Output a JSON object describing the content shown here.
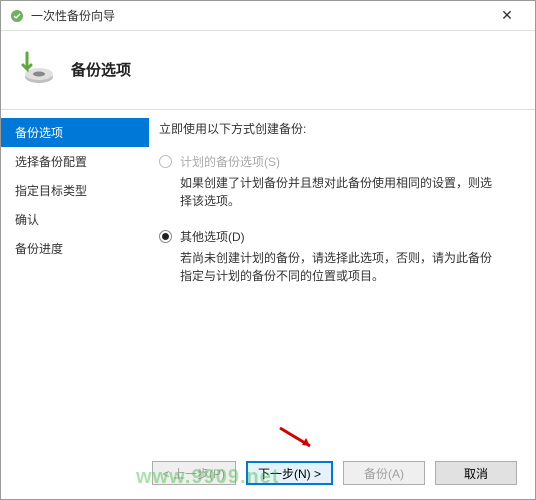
{
  "window": {
    "title": "一次性备份向导"
  },
  "header": {
    "title": "备份选项"
  },
  "sidebar": {
    "items": [
      {
        "label": "备份选项",
        "active": true
      },
      {
        "label": "选择备份配置",
        "active": false
      },
      {
        "label": "指定目标类型",
        "active": false
      },
      {
        "label": "确认",
        "active": false
      },
      {
        "label": "备份进度",
        "active": false
      }
    ]
  },
  "content": {
    "lead": "立即使用以下方式创建备份:",
    "options": [
      {
        "label": "计划的备份选项(S)",
        "desc": "如果创建了计划备份并且想对此备份使用相同的设置，则选择该选项。",
        "checked": false,
        "disabled": true
      },
      {
        "label": "其他选项(D)",
        "desc": "若尚未创建计划的备份，请选择此选项，否则，请为此备份指定与计划的备份不同的位置或项目。",
        "checked": true,
        "disabled": false
      }
    ]
  },
  "footer": {
    "back": "< 上一步(P)",
    "next": "下一步(N) >",
    "backup": "备份(A)",
    "cancel": "取消"
  },
  "watermark": "www.9909.net"
}
